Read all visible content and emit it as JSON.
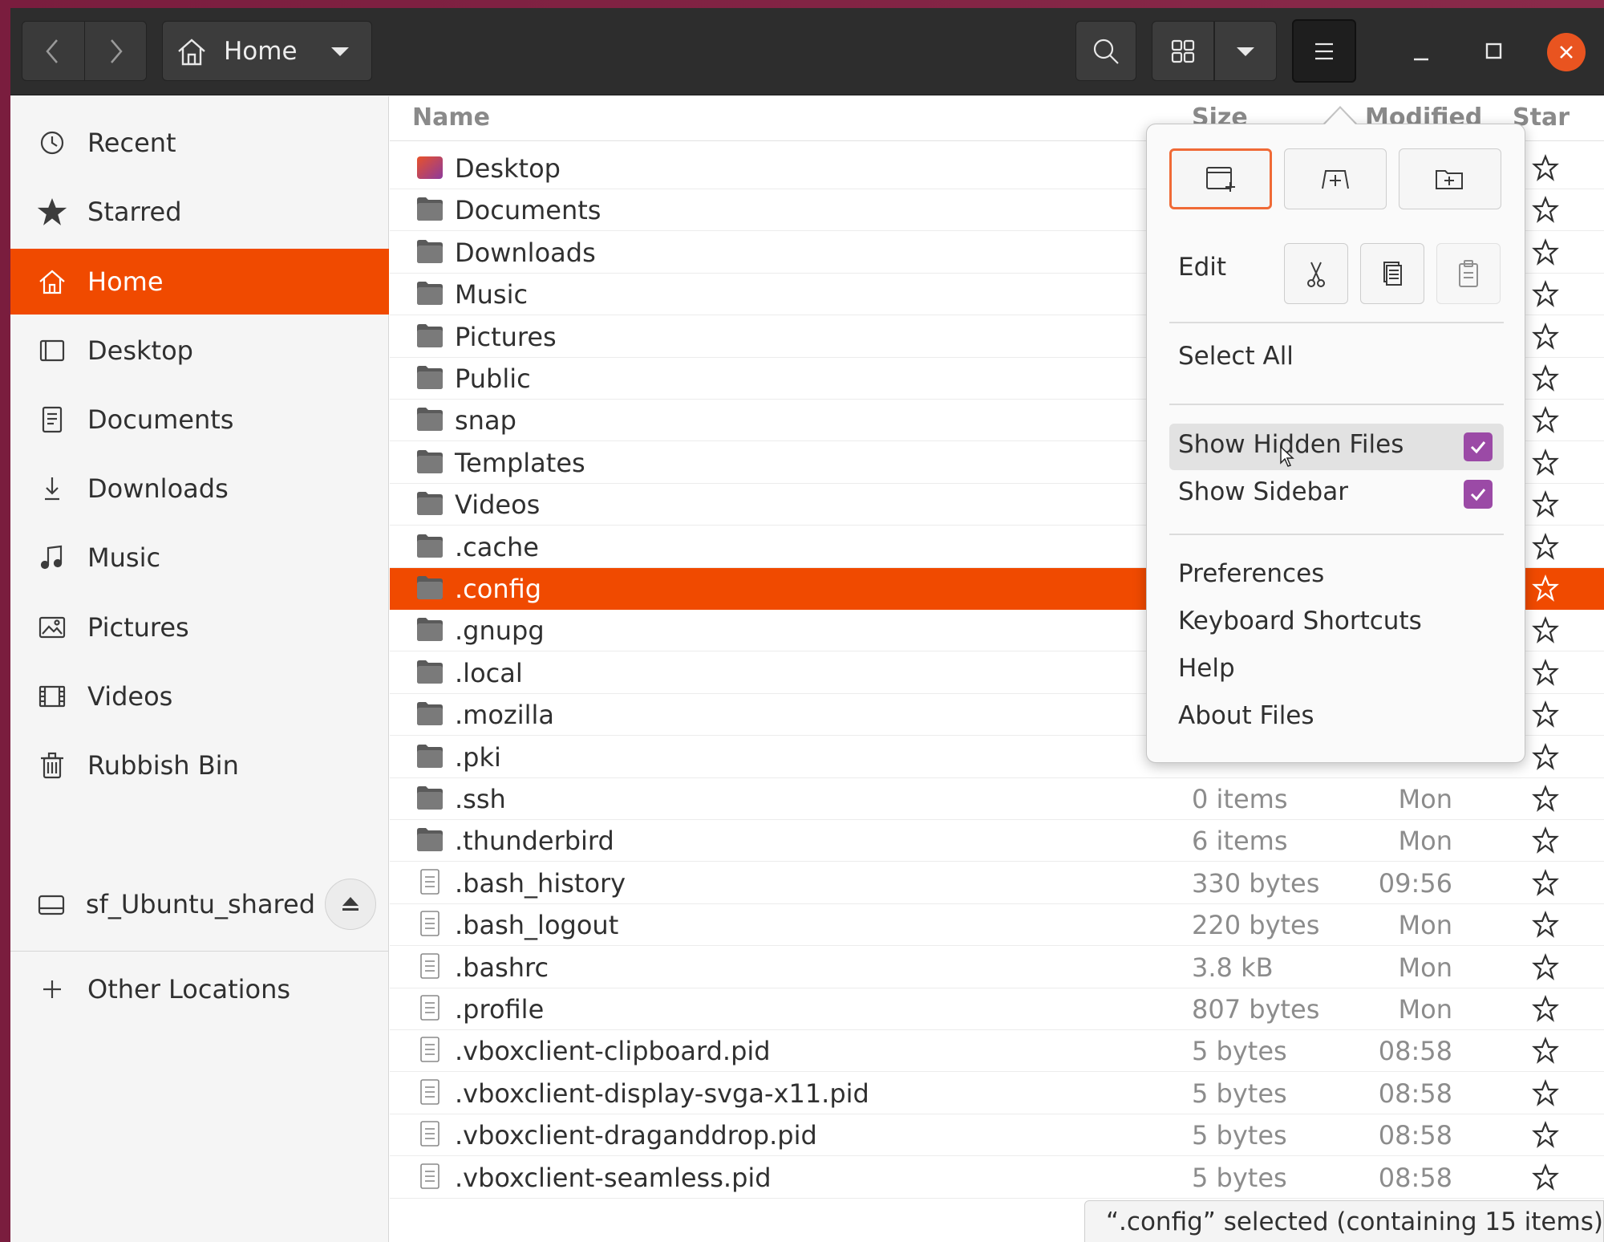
{
  "header": {
    "path_label": "Home"
  },
  "sidebar": {
    "items": [
      {
        "label": "Recent",
        "icon": "clock-icon"
      },
      {
        "label": "Starred",
        "icon": "star-icon"
      },
      {
        "label": "Home",
        "icon": "home-icon",
        "selected": true
      },
      {
        "label": "Desktop",
        "icon": "desktop-icon"
      },
      {
        "label": "Documents",
        "icon": "document-icon"
      },
      {
        "label": "Downloads",
        "icon": "download-icon"
      },
      {
        "label": "Music",
        "icon": "music-icon"
      },
      {
        "label": "Pictures",
        "icon": "picture-icon"
      },
      {
        "label": "Videos",
        "icon": "video-icon"
      },
      {
        "label": "Rubbish Bin",
        "icon": "trash-icon"
      },
      {
        "label": "sf_Ubuntu_shared",
        "icon": "drive-icon"
      }
    ],
    "other_locations": "Other Locations"
  },
  "columns": {
    "name": "Name",
    "size": "Size",
    "modified": "Modified",
    "star": "Star"
  },
  "files": [
    {
      "name": "Desktop",
      "type": "folder",
      "size": "",
      "modified": ""
    },
    {
      "name": "Documents",
      "type": "folder",
      "size": "",
      "modified": ""
    },
    {
      "name": "Downloads",
      "type": "folder",
      "size": "",
      "modified": ""
    },
    {
      "name": "Music",
      "type": "folder",
      "size": "",
      "modified": ""
    },
    {
      "name": "Pictures",
      "type": "folder",
      "size": "",
      "modified": ""
    },
    {
      "name": "Public",
      "type": "folder",
      "size": "",
      "modified": ""
    },
    {
      "name": "snap",
      "type": "folder",
      "size": "",
      "modified": ""
    },
    {
      "name": "Templates",
      "type": "folder",
      "size": "",
      "modified": ""
    },
    {
      "name": "Videos",
      "type": "folder",
      "size": "",
      "modified": ""
    },
    {
      "name": ".cache",
      "type": "folder",
      "size": "",
      "modified": ""
    },
    {
      "name": ".config",
      "type": "folder",
      "size": "",
      "modified": "",
      "selected": true
    },
    {
      "name": ".gnupg",
      "type": "folder",
      "size": "",
      "modified": ""
    },
    {
      "name": ".local",
      "type": "folder",
      "size": "",
      "modified": ""
    },
    {
      "name": ".mozilla",
      "type": "folder",
      "size": "",
      "modified": ""
    },
    {
      "name": ".pki",
      "type": "folder",
      "size": "",
      "modified": ""
    },
    {
      "name": ".ssh",
      "type": "folder",
      "size": "0 items",
      "modified": "Mon"
    },
    {
      "name": ".thunderbird",
      "type": "folder",
      "size": "6 items",
      "modified": "Mon"
    },
    {
      "name": ".bash_history",
      "type": "file",
      "size": "330 bytes",
      "modified": "09:56"
    },
    {
      "name": ".bash_logout",
      "type": "file",
      "size": "220 bytes",
      "modified": "Mon"
    },
    {
      "name": ".bashrc",
      "type": "file",
      "size": "3.8 kB",
      "modified": "Mon"
    },
    {
      "name": ".profile",
      "type": "file",
      "size": "807 bytes",
      "modified": "Mon"
    },
    {
      "name": ".vboxclient-clipboard.pid",
      "type": "file",
      "size": "5 bytes",
      "modified": "08:58"
    },
    {
      "name": ".vboxclient-display-svga-x11.pid",
      "type": "file",
      "size": "5 bytes",
      "modified": "08:58"
    },
    {
      "name": ".vboxclient-draganddrop.pid",
      "type": "file",
      "size": "5 bytes",
      "modified": "08:58"
    },
    {
      "name": ".vboxclient-seamless.pid",
      "type": "file",
      "size": "5 bytes",
      "modified": "08:58"
    }
  ],
  "status": {
    "text": "“.config” selected  (containing 15 items)"
  },
  "menu": {
    "edit_label": "Edit",
    "select_all": "Select All",
    "show_hidden_files": "Show Hidden Files",
    "show_hidden_checked": true,
    "show_sidebar": "Show Sidebar",
    "show_sidebar_checked": true,
    "preferences": "Preferences",
    "keyboard_shortcuts": "Keyboard Shortcuts",
    "help": "Help",
    "about": "About Files"
  },
  "colors": {
    "accent": "#f04a00",
    "checkbox": "#9b4aa6",
    "header": "#2d2d2d"
  }
}
